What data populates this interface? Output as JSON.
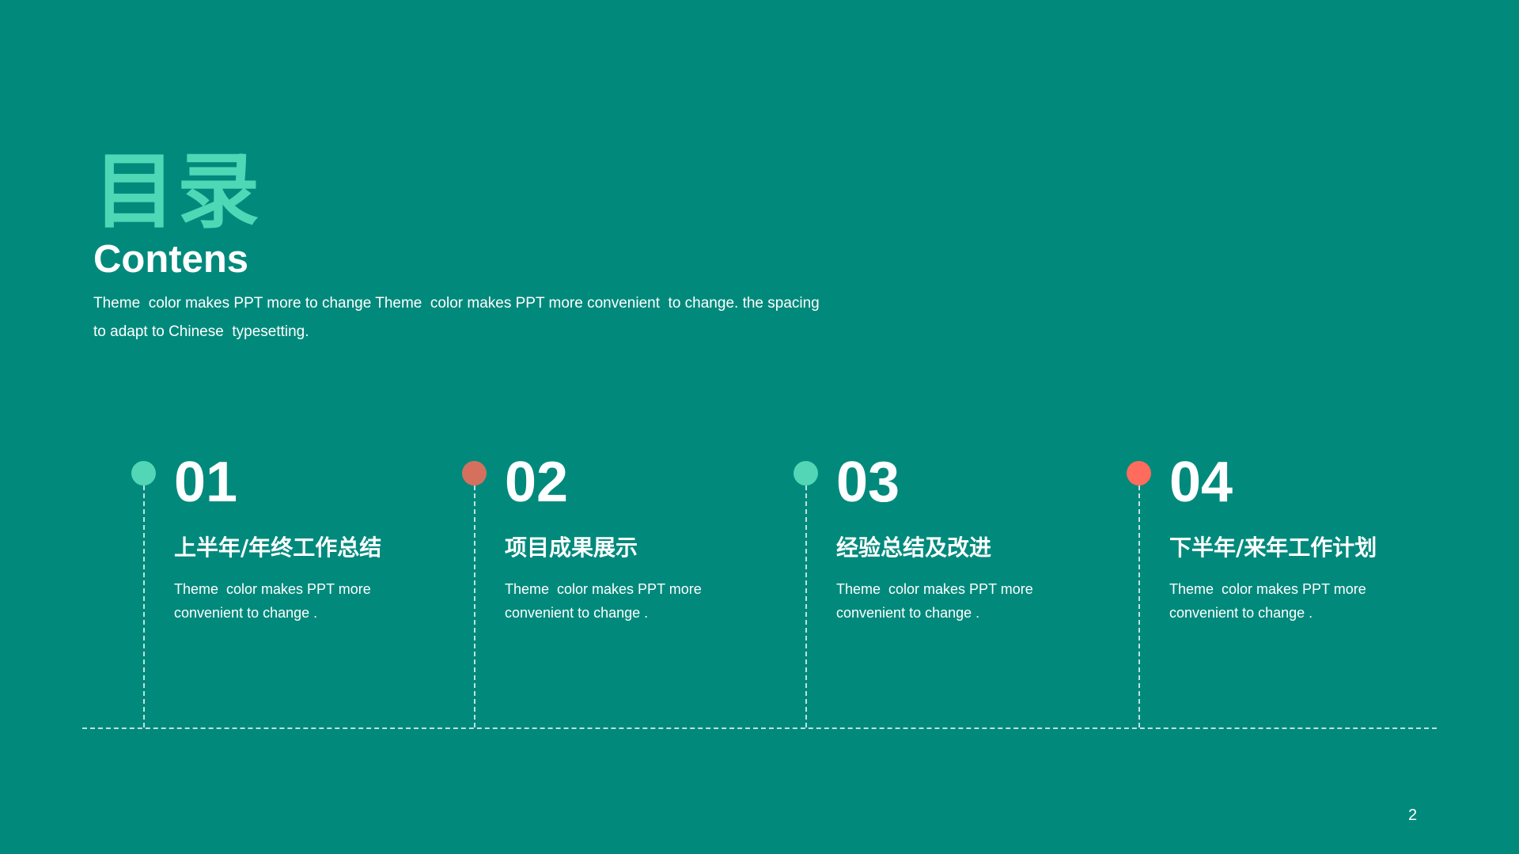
{
  "slide": {
    "title_cn": "目录",
    "title_en": "Contens",
    "intro": "Theme  color makes PPT more to change Theme  color makes PPT more convenient  to change. the spacing  to adapt to Chinese  typesetting.",
    "page_number": "2"
  },
  "colors": {
    "background": "#018a7c",
    "title_cn": "#4fd8b6",
    "dot_teal": "#52d6b5",
    "dot_salmon": "#d5705f",
    "dot_coral": "#ff6b5c",
    "text": "#ffffff"
  },
  "items": [
    {
      "number": "01",
      "heading": "上半年/年终工作总结",
      "description": "Theme  color makes PPT more convenient to change .",
      "dot_color": "#52d6b5"
    },
    {
      "number": "02",
      "heading": "项目成果展示",
      "description": "Theme  color makes PPT more convenient to change .",
      "dot_color": "#d5705f"
    },
    {
      "number": "03",
      "heading": "经验总结及改进",
      "description": "Theme  color makes PPT more convenient to change .",
      "dot_color": "#52d6b5"
    },
    {
      "number": "04",
      "heading": "下半年/来年工作计划",
      "description": "Theme  color makes PPT more convenient to change .",
      "dot_color": "#ff6b5c"
    }
  ]
}
